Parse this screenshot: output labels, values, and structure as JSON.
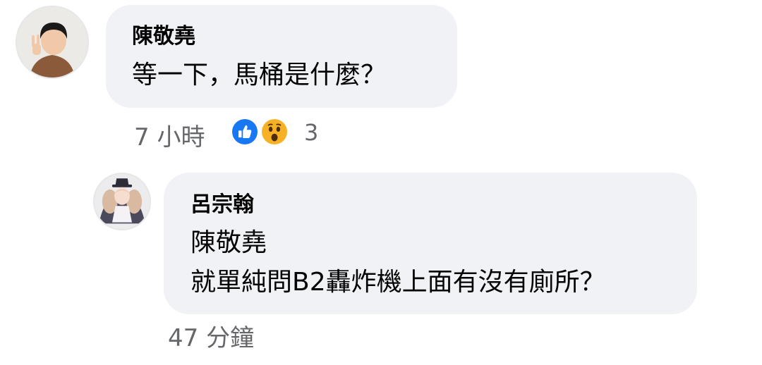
{
  "comment1": {
    "author": "陳敬堯",
    "text": "等一下，馬桶是什麼？",
    "time": "7 小時",
    "reactions": {
      "icons": [
        "like-icon",
        "wow-icon"
      ],
      "count": "3"
    }
  },
  "reply1": {
    "author": "呂宗翰",
    "mention": "陳敬堯",
    "text": "就單純問B2轟炸機上面有沒有廁所？",
    "time": "47 分鐘"
  },
  "colors": {
    "bubble": "#f0f2f5",
    "like": "#1877f2",
    "wow": "#f7b125",
    "meta_text": "#65676b"
  }
}
